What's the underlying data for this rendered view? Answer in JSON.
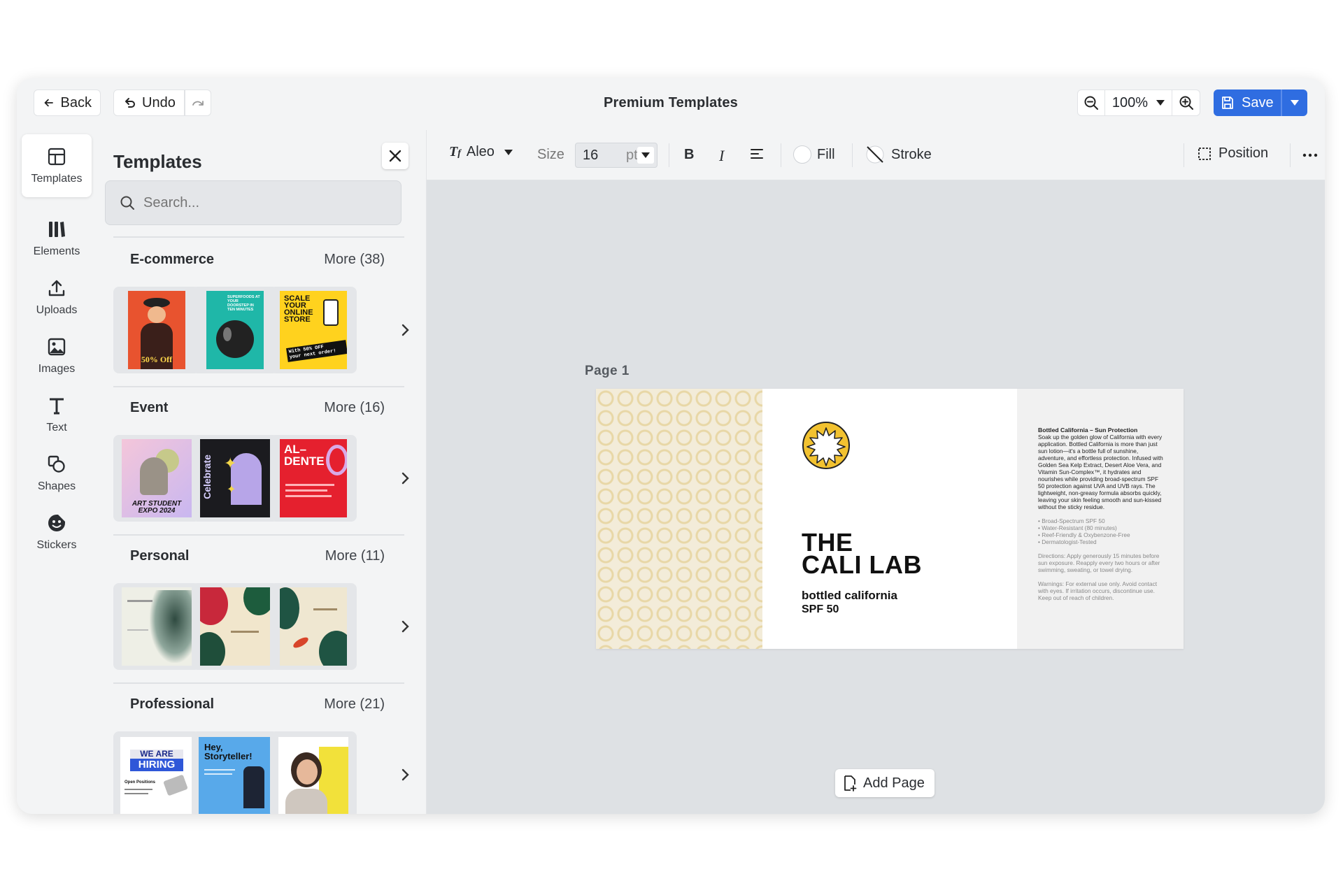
{
  "header": {
    "back_label": "Back",
    "undo_label": "Undo",
    "title": "Premium Templates",
    "zoom": "100%",
    "save_label": "Save"
  },
  "rail": [
    {
      "label": "Templates",
      "icon": "templates-icon",
      "active": true
    },
    {
      "label": "Elements",
      "icon": "elements-icon"
    },
    {
      "label": "Uploads",
      "icon": "upload-icon"
    },
    {
      "label": "Images",
      "icon": "image-icon"
    },
    {
      "label": "Text",
      "icon": "text-icon"
    },
    {
      "label": "Shapes",
      "icon": "shapes-icon"
    },
    {
      "label": "Stickers",
      "icon": "sticker-icon"
    }
  ],
  "panel": {
    "title": "Templates",
    "search_placeholder": "Search...",
    "categories": [
      {
        "name": "E-commerce",
        "more": "More (38)"
      },
      {
        "name": "Event",
        "more": "More (16)"
      },
      {
        "name": "Personal",
        "more": "More (11)"
      },
      {
        "name": "Professional",
        "more": "More (21)"
      }
    ],
    "thumbs": {
      "scale": [
        "SCALE",
        "YOUR",
        "ONLINE",
        "STORE",
        "With 50% OFF",
        "your next order!"
      ],
      "superfoods": "SUPERFOODS AT YOUR DOORSTEP IN TEN MINUTES",
      "fashion_off": "50% Off",
      "art_student": [
        "ART STUDENT",
        "EXPO 2024"
      ],
      "celebrate": "Celebrate",
      "al_dente": [
        "AL–",
        "DENTE"
      ],
      "we_are": "WE ARE",
      "hiring": "HIRING",
      "open_positions": "Open Positions",
      "storyteller": [
        "Hey,",
        "Storyteller!"
      ]
    }
  },
  "toolbar": {
    "font": "Aleo",
    "size_label": "Size",
    "size_value": "16",
    "size_unit": "pt",
    "bold": "B",
    "italic": "I",
    "fill_label": "Fill",
    "stroke_label": "Stroke",
    "position_label": "Position"
  },
  "canvas": {
    "page_label": "Page  1",
    "brand_line1": "THE",
    "brand_line2": "CALI LAB",
    "product": "bottled california",
    "spf": "SPF 50",
    "back_title": "Bottled California – Sun Protection",
    "back_body": "Soak up the golden glow of California with every application. Bottled California is more than just sun lotion—it's a bottle full of sunshine, adventure, and effortless protection. Infused with Golden Sea Kelp Extract, Desert Aloe Vera, and Vitamin Sun-Complex™, it hydrates and nourishes while providing broad-spectrum SPF 50 protection against UVA and UVB rays. The lightweight, non-greasy formula absorbs quickly, leaving your skin feeling smooth and sun-kissed without the sticky residue.",
    "back_features": [
      "• Broad-Spectrum SPF 50",
      "• Water-Resistant (80 minutes)",
      "• Reef-Friendly & Oxybenzone-Free",
      "• Dermatologist-Tested"
    ],
    "back_directions": "Directions: Apply generously 15 minutes before sun exposure. Reapply every two hours or after swimming, sweating, or towel drying.",
    "back_warnings": "Warnings: For external use only. Avoid contact with eyes. If irritation occurs, discontinue use. Keep out of reach of children.",
    "add_page_label": "Add Page"
  },
  "colors": {
    "accent": "#2f6de1",
    "sun": "#f2c230",
    "canvas_bg": "#dee1e4"
  }
}
